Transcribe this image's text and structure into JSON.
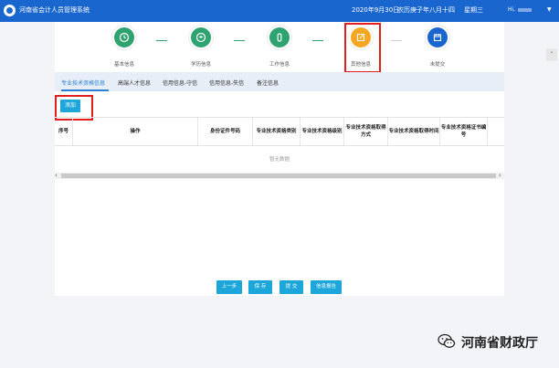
{
  "topbar": {
    "app_title": "河南省会计人员管理系统",
    "date": "2020年9月30日",
    "lunar_date": "农历庚子年八月十四",
    "weekday": "星期三",
    "user_prefix": "Hi,",
    "caret": "▼",
    "color": "#1a66cf"
  },
  "steps": [
    {
      "label": "基本信息",
      "color": "#2fa36f",
      "icon": "clock-icon"
    },
    {
      "label": "学历信息",
      "color": "#2fa36f",
      "icon": "graduation-icon"
    },
    {
      "label": "工作信息",
      "color": "#2fa36f",
      "icon": "briefcase-icon"
    },
    {
      "label": "其他信息",
      "color": "#f5a623",
      "icon": "edit-icon"
    },
    {
      "label": "未提交",
      "color": "#1a66cf",
      "icon": "calendar-icon"
    }
  ],
  "tabs": [
    {
      "label": "专业技术资格信息",
      "active": true
    },
    {
      "label": "高端人才信息",
      "active": false
    },
    {
      "label": "信用信息-守信",
      "active": false
    },
    {
      "label": "信用信息-失信",
      "active": false
    },
    {
      "label": "备注信息",
      "active": false
    }
  ],
  "add_button": "添加",
  "table": {
    "columns": [
      "序号",
      "操作",
      "身份证件号码",
      "专业技术资格类别",
      "专业技术资格级别",
      "专业技术资格取得方式",
      "专业技术资格取得时间",
      "专业技术资格证书编号"
    ],
    "empty_text": "暂无数据"
  },
  "scroll": {
    "left": "‹",
    "right": "›",
    "up": "⌃"
  },
  "buttons": {
    "prev": "上一步",
    "save": "保 存",
    "submit": "提 交",
    "report": "信息报告"
  },
  "watermark": {
    "text": "河南省财政厅",
    "icon": "wechat-icon"
  },
  "colors": {
    "accent": "#1da6d9",
    "highlight": "#e21f1f",
    "done": "#2fa36f",
    "current": "#f5a623"
  }
}
